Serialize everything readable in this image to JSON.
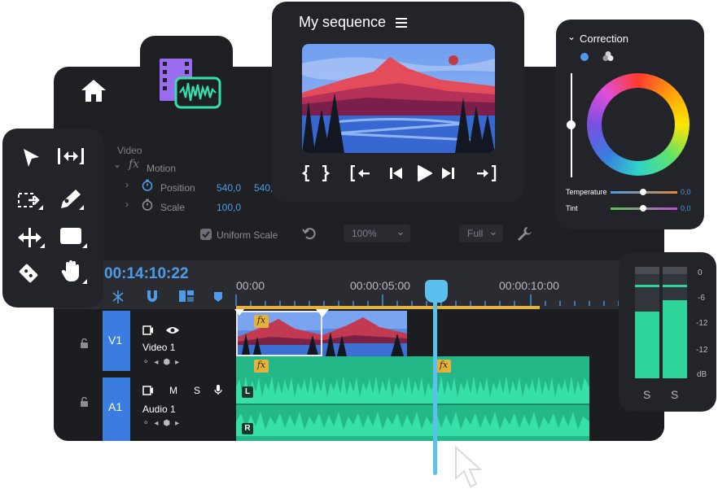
{
  "effect_controls": {
    "section": "Video",
    "effect": "Motion",
    "position_label": "Position",
    "position_x": "540,0",
    "position_y": "540,",
    "scale_label": "Scale",
    "scale_value": "100,0",
    "uniform_scale": "Uniform Scale",
    "zoom": "100%",
    "resolution": "Full"
  },
  "monitor": {
    "title": "My sequence"
  },
  "correction": {
    "title": "Correction",
    "temperature_label": "Temperature",
    "temperature_value": "0,0",
    "tint_label": "Tint",
    "tint_value": "0,0",
    "colors": {
      "temperature_left": "#4e9be9",
      "temperature_right": "#e08a3a",
      "tint_left": "#5ec84f",
      "tint_right": "#c04fd8"
    }
  },
  "timeline": {
    "timecode": "00:14:10:22",
    "ruler": [
      "00:00",
      "00:00:05:00",
      "00:00:10:00"
    ],
    "tracks": [
      {
        "id": "V1",
        "name": "Video 1"
      },
      {
        "id": "A1",
        "name": "Audio 1",
        "m": "M",
        "s": "S"
      }
    ],
    "fx_label": "fx",
    "left_channel": "L",
    "right_channel": "R",
    "colors": {
      "playhead": "#5bc0ee",
      "audio": "#2ed39a",
      "work_area": "#e3b23c",
      "track_header": "#3a7ce0"
    }
  },
  "meter": {
    "scale": [
      "0",
      "-6",
      "-12",
      "-12",
      "dB"
    ],
    "solo_left": "S",
    "solo_right": "S",
    "levels": [
      0.6,
      0.7
    ]
  },
  "tools": [
    "selection-tool",
    "ripple-edit-tool",
    "track-select-tool",
    "pen-tool",
    "move-tool",
    "rectangle-tool",
    "razor-tool",
    "hand-tool"
  ]
}
